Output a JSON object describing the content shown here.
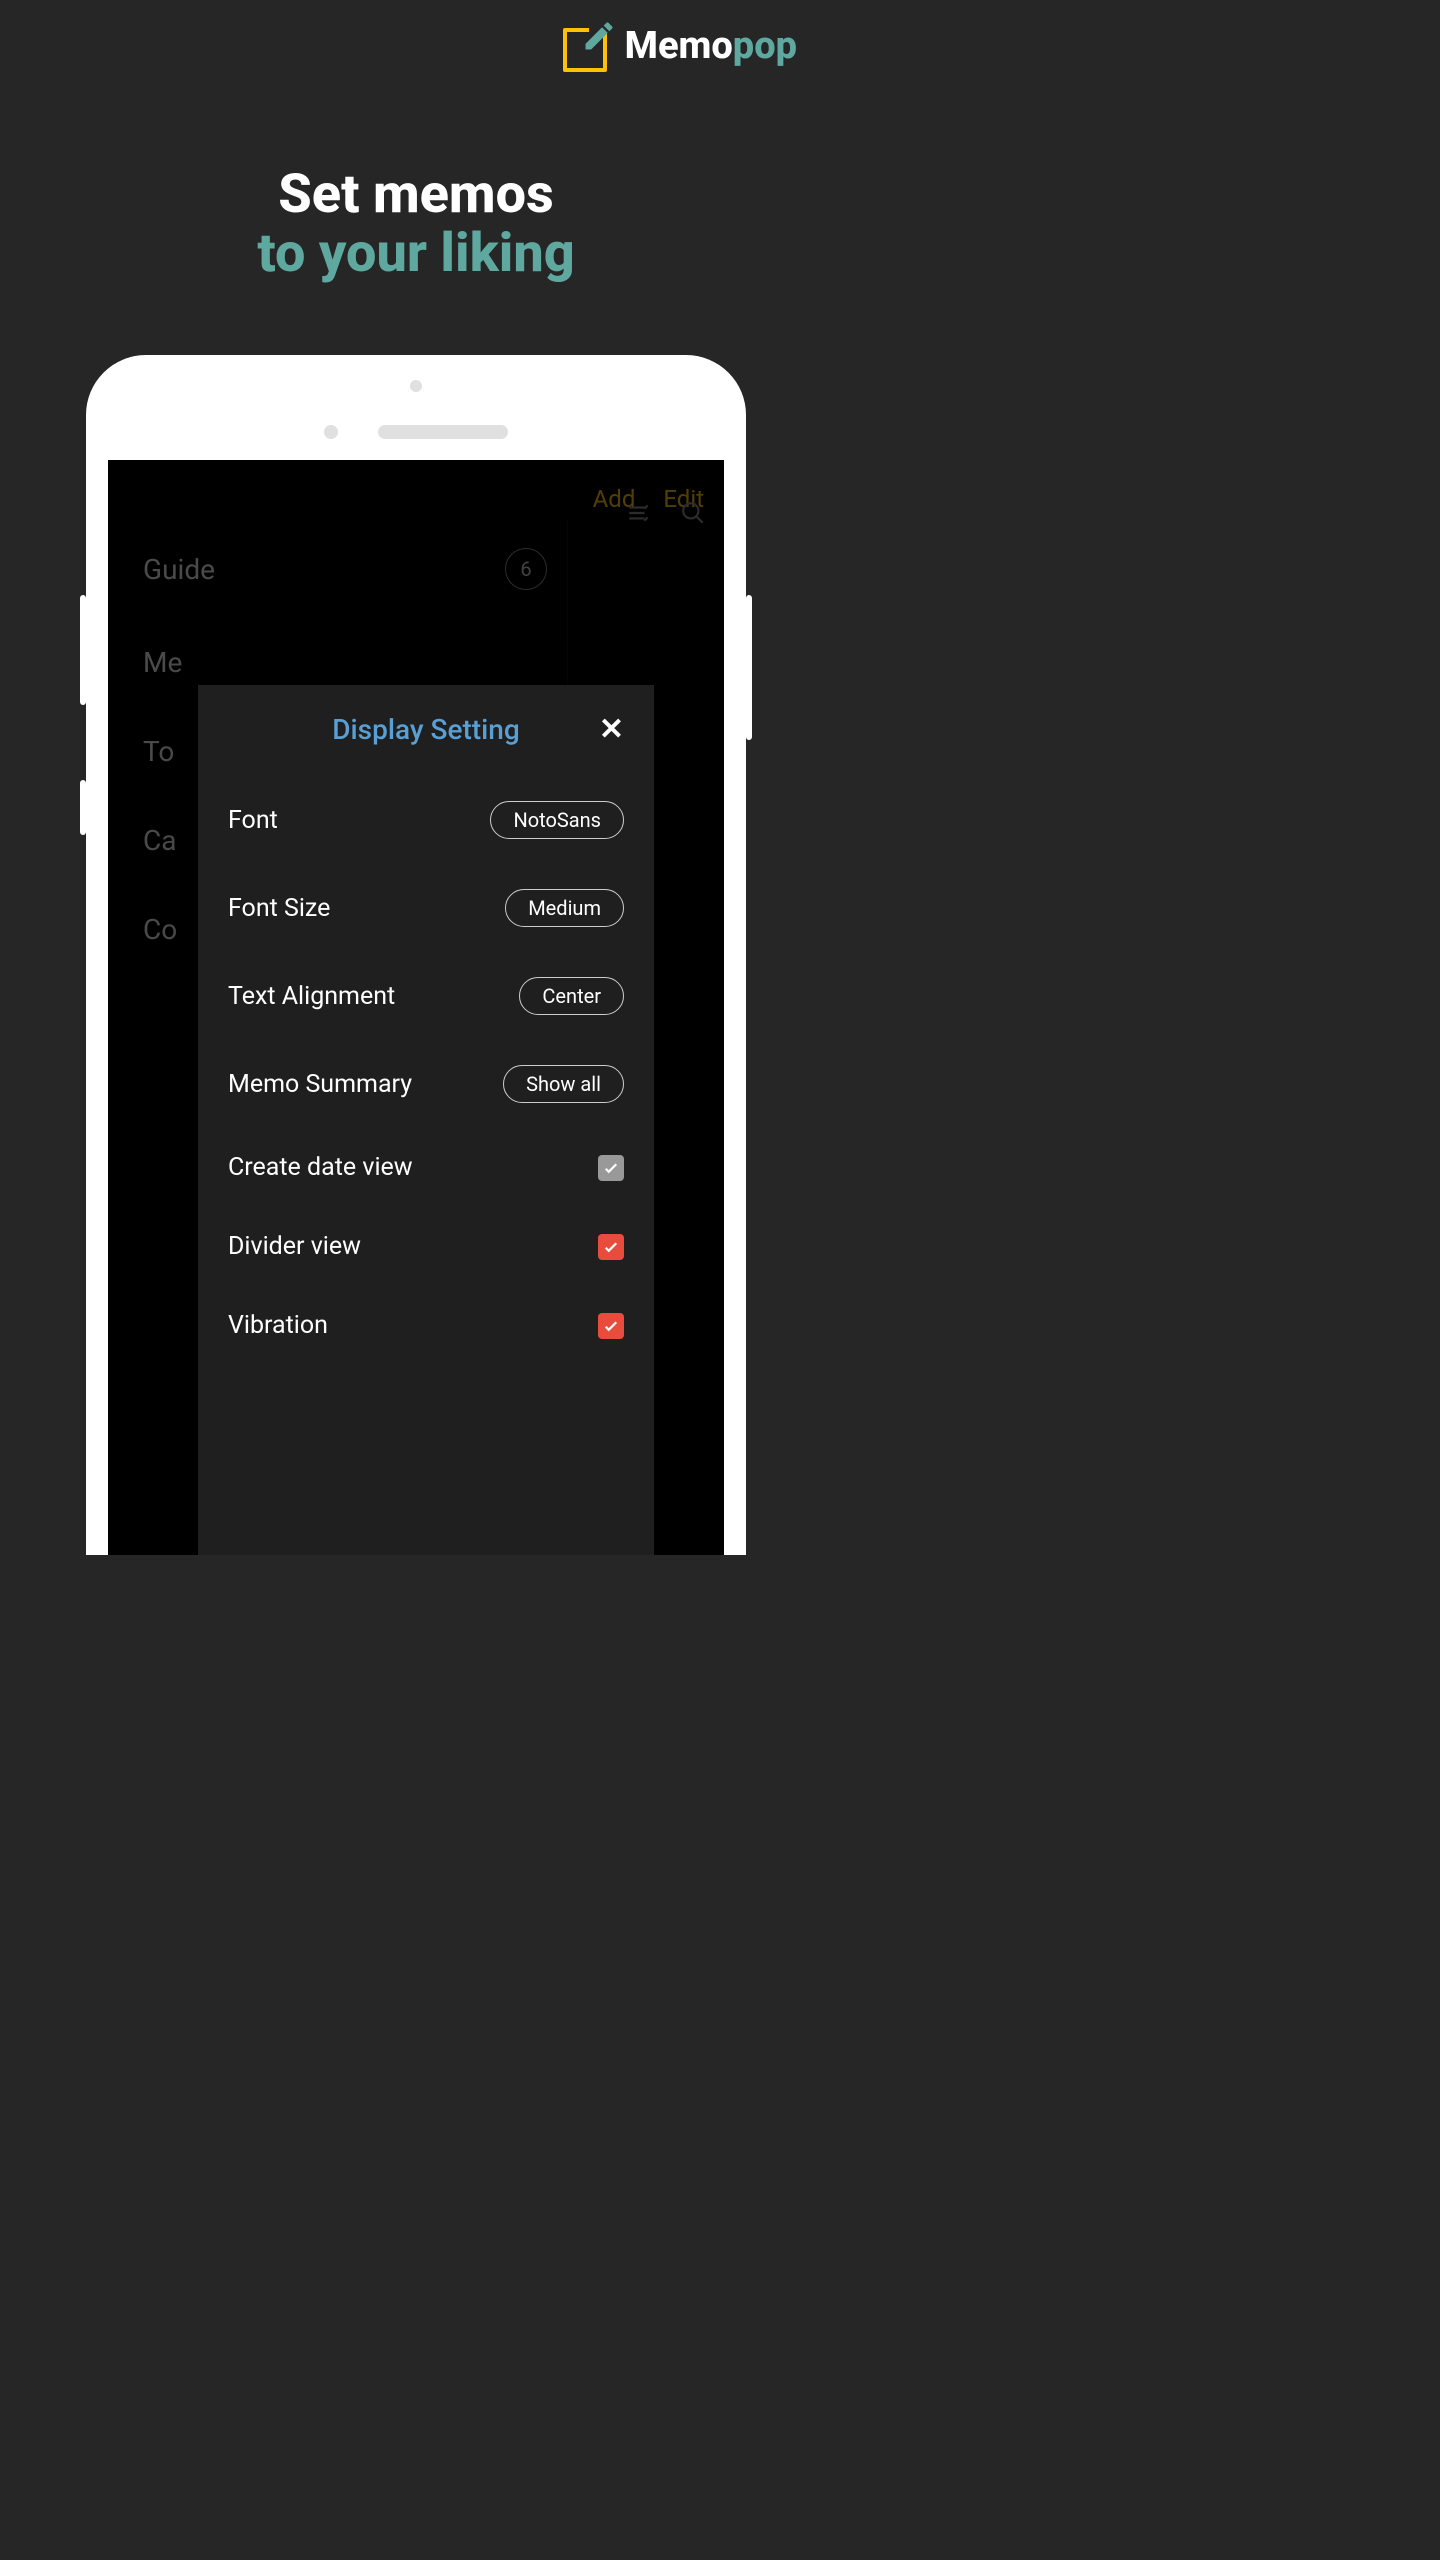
{
  "logo": {
    "name_part1": "Memo",
    "name_part2": "pop"
  },
  "tagline": {
    "line1": "Set memos",
    "line2": "to your liking"
  },
  "app_header": {
    "add": "Add",
    "edit": "Edit"
  },
  "sidebar": {
    "items": [
      {
        "label": "Guide",
        "count": "6"
      },
      {
        "label": "Me"
      },
      {
        "label": "To"
      },
      {
        "label": "Ca"
      },
      {
        "label": "Co"
      }
    ]
  },
  "modal": {
    "title": "Display Setting",
    "rows": [
      {
        "label": "Font",
        "value": "NotoSans"
      },
      {
        "label": "Font Size",
        "value": "Medium"
      },
      {
        "label": "Text Alignment",
        "value": "Center"
      },
      {
        "label": "Memo Summary",
        "value": "Show all"
      }
    ],
    "checks": [
      {
        "label": "Create date view",
        "checked": true,
        "color": "grey"
      },
      {
        "label": "Divider view",
        "checked": true,
        "color": "red"
      },
      {
        "label": "Vibration",
        "checked": true,
        "color": "red"
      }
    ]
  }
}
